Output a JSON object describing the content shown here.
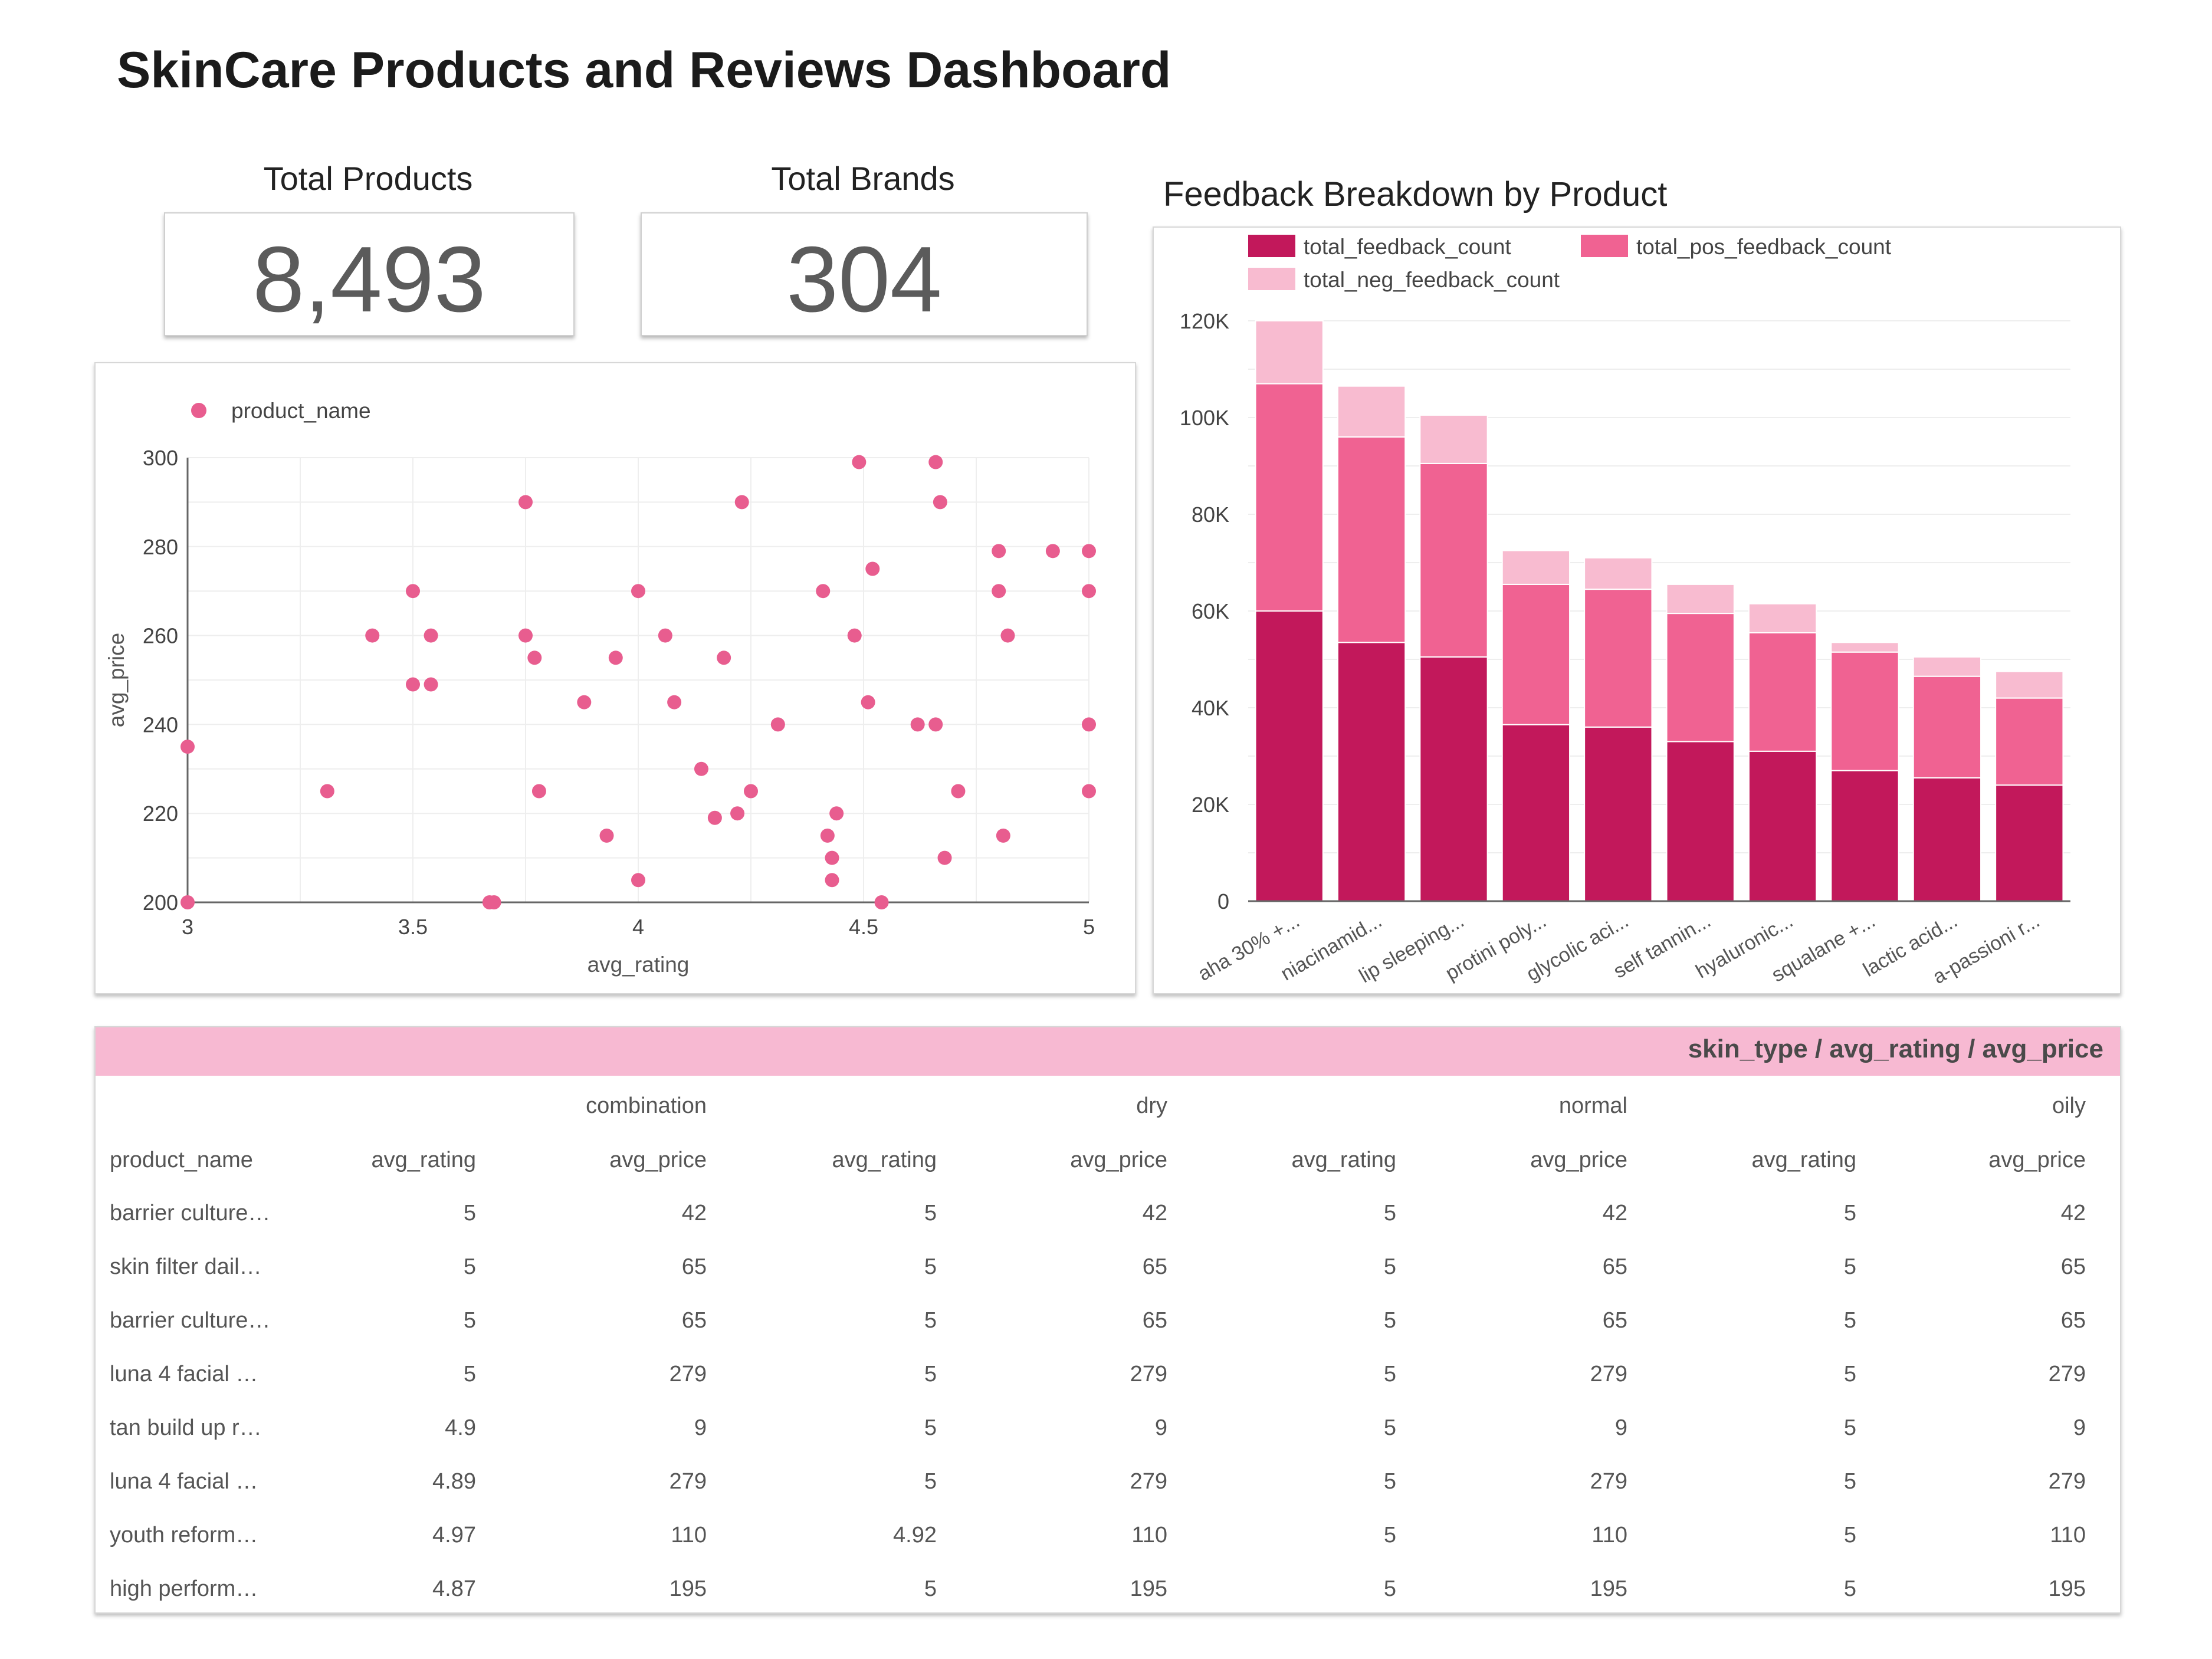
{
  "dashboard": {
    "title": "SkinCare Products and Reviews Dashboard"
  },
  "scorecards": [
    {
      "label": "Total Products",
      "value": "8,493"
    },
    {
      "label": "Total Brands",
      "value": "304"
    }
  ],
  "colors": {
    "accent": "#e85d8f",
    "feedback": "#c2185b",
    "pos_feedback": "#f06292",
    "neg_feedback": "#f8bbd0",
    "table_header": "#f7b9d2"
  },
  "chart_data": [
    {
      "type": "scatter",
      "legend": "product_name",
      "legend_position": "top-left",
      "xlabel": "avg_rating",
      "ylabel": "avg_price",
      "xlim": [
        3,
        5
      ],
      "ylim": [
        200,
        300
      ],
      "x_ticks": [
        "3",
        "3.5",
        "4",
        "4.5",
        "5"
      ],
      "y_ticks": [
        "200",
        "220",
        "240",
        "260",
        "280",
        "300"
      ],
      "grid": true,
      "points": [
        [
          3.0,
          235
        ],
        [
          3.0,
          200
        ],
        [
          3.31,
          225
        ],
        [
          3.41,
          260
        ],
        [
          3.5,
          270
        ],
        [
          3.5,
          249
        ],
        [
          3.54,
          260
        ],
        [
          3.54,
          249
        ],
        [
          3.67,
          200
        ],
        [
          3.68,
          200
        ],
        [
          3.75,
          290
        ],
        [
          3.75,
          260
        ],
        [
          3.77,
          255
        ],
        [
          3.78,
          225
        ],
        [
          3.88,
          245
        ],
        [
          3.93,
          215
        ],
        [
          3.95,
          255
        ],
        [
          4.0,
          270
        ],
        [
          4.0,
          205
        ],
        [
          4.06,
          260
        ],
        [
          4.08,
          245
        ],
        [
          4.14,
          230
        ],
        [
          4.17,
          219
        ],
        [
          4.19,
          255
        ],
        [
          4.22,
          220
        ],
        [
          4.23,
          290
        ],
        [
          4.25,
          225
        ],
        [
          4.31,
          240
        ],
        [
          4.41,
          270
        ],
        [
          4.42,
          215
        ],
        [
          4.43,
          210
        ],
        [
          4.43,
          205
        ],
        [
          4.44,
          220
        ],
        [
          4.48,
          260
        ],
        [
          4.49,
          299
        ],
        [
          4.51,
          245
        ],
        [
          4.52,
          275
        ],
        [
          4.54,
          200
        ],
        [
          4.62,
          240
        ],
        [
          4.66,
          299
        ],
        [
          4.66,
          240
        ],
        [
          4.67,
          290
        ],
        [
          4.68,
          210
        ],
        [
          4.71,
          225
        ],
        [
          4.8,
          279
        ],
        [
          4.8,
          270
        ],
        [
          4.81,
          215
        ],
        [
          4.82,
          260
        ],
        [
          4.92,
          279
        ],
        [
          5.0,
          279
        ],
        [
          5.0,
          270
        ],
        [
          5.0,
          240
        ],
        [
          5.0,
          225
        ]
      ]
    },
    {
      "type": "bar",
      "stacked": true,
      "title": "Feedback Breakdown by Product",
      "legend_position": "top",
      "ylim": [
        0,
        120000
      ],
      "y_ticks": [
        "0",
        "20K",
        "40K",
        "60K",
        "80K",
        "100K",
        "120K"
      ],
      "categories": [
        "aha 30% +...",
        "niacinamid...",
        "lip sleeping...",
        "protini poly...",
        "glycolic aci...",
        "self tannin...",
        "hyaluronic...",
        "squalane +...",
        "lactic acid...",
        "a-passioni r..."
      ],
      "series": [
        {
          "name": "total_feedback_count",
          "values": [
            60000,
            53500,
            50500,
            36500,
            36000,
            33000,
            31000,
            27000,
            25500,
            24000
          ]
        },
        {
          "name": "total_pos_feedback_count",
          "values": [
            47000,
            42500,
            40000,
            29000,
            28500,
            26500,
            24500,
            24500,
            21000,
            18000
          ]
        },
        {
          "name": "total_neg_feedback_count",
          "values": [
            13000,
            10500,
            10000,
            7000,
            6500,
            6000,
            6000,
            2000,
            4000,
            5500
          ]
        }
      ]
    },
    {
      "type": "table",
      "header": "skin_type / avg_rating / avg_price",
      "skin_types": [
        "combination",
        "dry",
        "normal",
        "oily"
      ],
      "columns": [
        "product_name",
        "avg_rating",
        "avg_price",
        "avg_rating",
        "avg_price",
        "avg_rating",
        "avg_price",
        "avg_rating",
        "avg_price"
      ],
      "rows": [
        [
          "barrier culture…",
          "5",
          "42",
          "5",
          "42",
          "5",
          "42",
          "5",
          "42"
        ],
        [
          "skin filter dail…",
          "5",
          "65",
          "5",
          "65",
          "5",
          "65",
          "5",
          "65"
        ],
        [
          "barrier culture…",
          "5",
          "65",
          "5",
          "65",
          "5",
          "65",
          "5",
          "65"
        ],
        [
          "luna 4 facial …",
          "5",
          "279",
          "5",
          "279",
          "5",
          "279",
          "5",
          "279"
        ],
        [
          "tan build up r…",
          "4.9",
          "9",
          "5",
          "9",
          "5",
          "9",
          "5",
          "9"
        ],
        [
          "luna 4 facial …",
          "4.89",
          "279",
          "5",
          "279",
          "5",
          "279",
          "5",
          "279"
        ],
        [
          "youth reform…",
          "4.97",
          "110",
          "4.92",
          "110",
          "5",
          "110",
          "5",
          "110"
        ],
        [
          "high perform…",
          "4.87",
          "195",
          "5",
          "195",
          "5",
          "195",
          "5",
          "195"
        ]
      ]
    }
  ]
}
